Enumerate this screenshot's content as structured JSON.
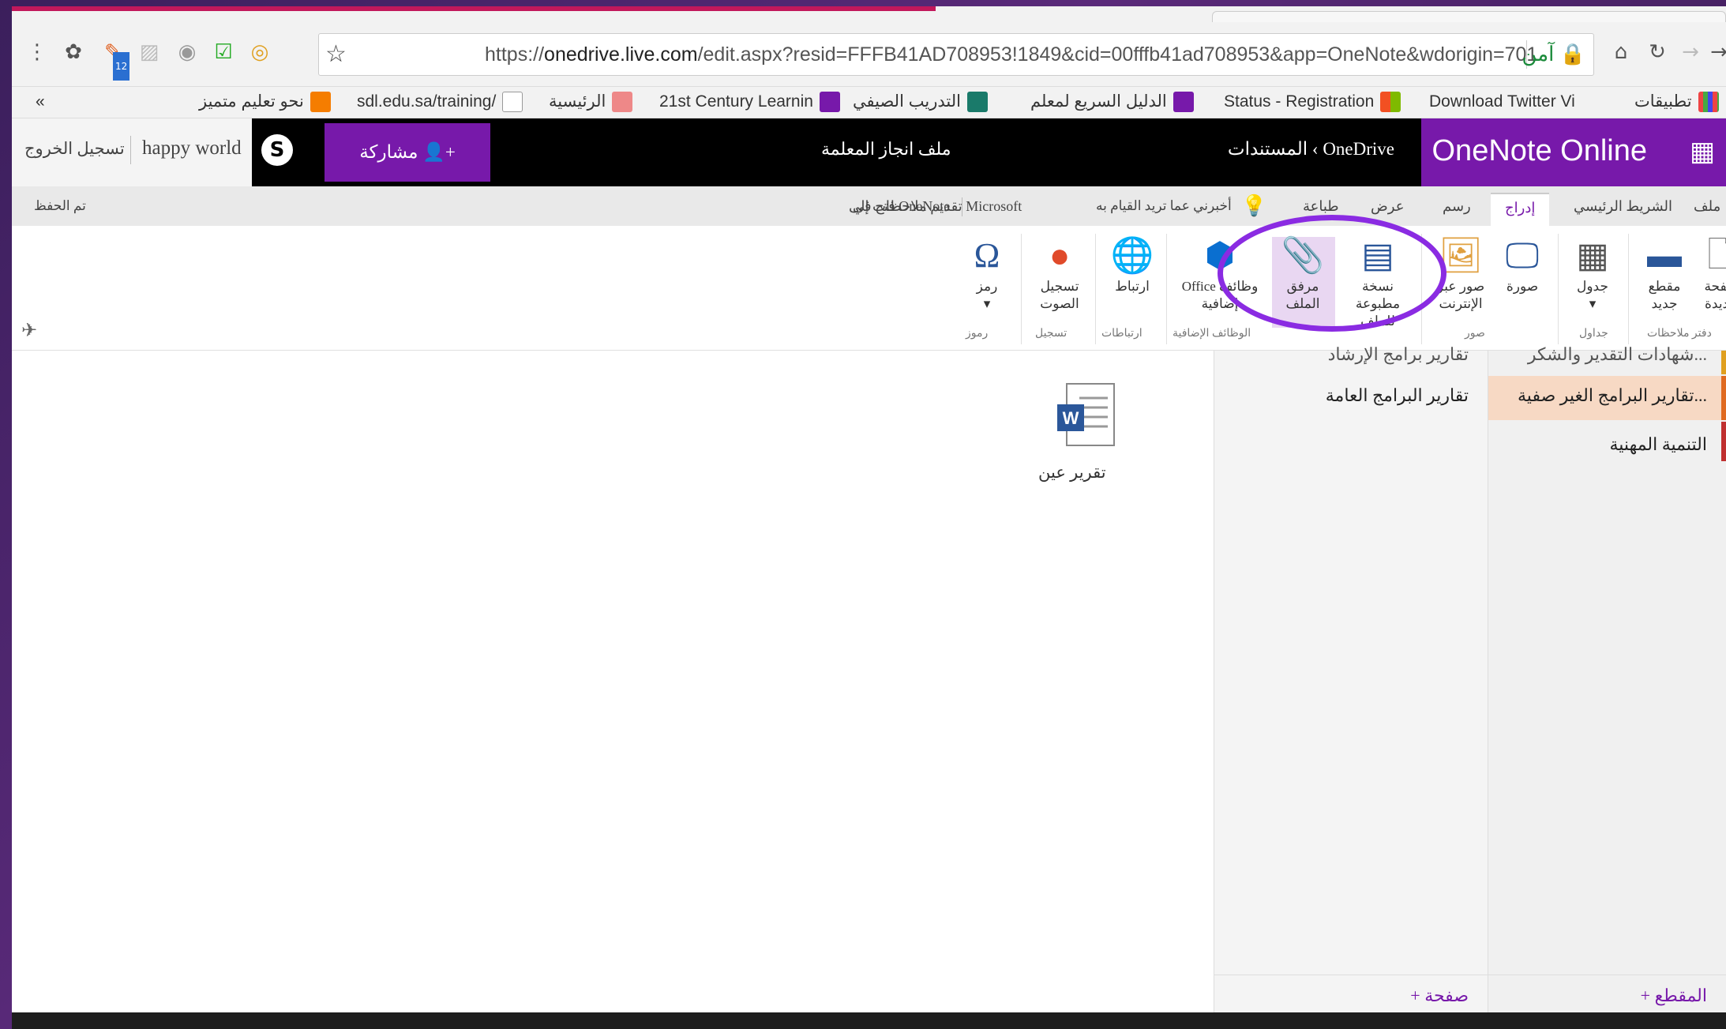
{
  "browser": {
    "url_prefix": "https://",
    "url_domain": "onedrive.live.com",
    "url_rest": "/edit.aspx?resid=FFFB41AD708953!1849&cid=00fffb41ad708953&app=OneNote&wdorigin=701",
    "secure_label": "آمن",
    "ext_badge": "12"
  },
  "bookmarks": {
    "apps": "تطبيقات",
    "items": [
      "Download Twitter Vi",
      "Status - Registration",
      "الدليل السريع لمعلم",
      "التدريب الصيفي",
      "21st Century Learnin",
      "الرئيسية",
      "sdl.edu.sa/training/",
      "نحو تعليم متميز"
    ],
    "more": "«"
  },
  "header": {
    "brand": "OneNote Online",
    "crumb_onedrive": "OneDrive",
    "crumb_sep": "‹",
    "crumb_docs": "المستندات",
    "doc_title": "ملف انجاز المعلمة",
    "share": "مشاركة",
    "user": "happy world",
    "signout": "تسجيل الخروج"
  },
  "tabs": {
    "file": "ملف",
    "home": "الشريط الرئيسي",
    "insert": "إدراج",
    "draw": "رسم",
    "view": "عرض",
    "print": "طباعة",
    "tell": "أخبرني عما تريد القيام به",
    "open_in": "فتح في OneNote",
    "feedback": "تقديم ملاحظات إلى Microsoft",
    "saved": "تم الحفظ"
  },
  "ribbon": {
    "new_page": "صفحة جديدة",
    "new_section": "مقطع جديد",
    "table": "جدول",
    "picture": "صورة",
    "online_pictures": "صور عبر الإنترنت",
    "file_printout": "نسخة مطبوعة للملف",
    "file_attachment": "مرفق الملف",
    "addins": "وظائف إضافية",
    "office": "Office",
    "link": "ارتباط",
    "record_audio": "تسجيل الصوت",
    "symbol": "رمز",
    "groups": {
      "notebook": "دفتر ملاحظات",
      "tables": "جداول",
      "pictures": "صور",
      "addins": "الوظائف الإضافية",
      "links": "ارتباطات",
      "recording": "تسجيل",
      "symbols": "رموز"
    }
  },
  "content": {
    "attachment_name": "تقرير عين"
  },
  "pages_pane": {
    "items": [
      "تقارير برامج الإرشاد",
      "تقارير البرامج العامة"
    ],
    "add": "+ صفحة"
  },
  "sections_pane": {
    "items": [
      "شهادات التقدير والشكر...",
      "تقارير البرامج الغير صفية...",
      "التنمية المهنية"
    ],
    "add": "+ المقطع"
  },
  "colors": {
    "onenote_purple": "#7719aa",
    "annotation_circle": "#8a2be2",
    "active_section": "#f7d9c4"
  }
}
